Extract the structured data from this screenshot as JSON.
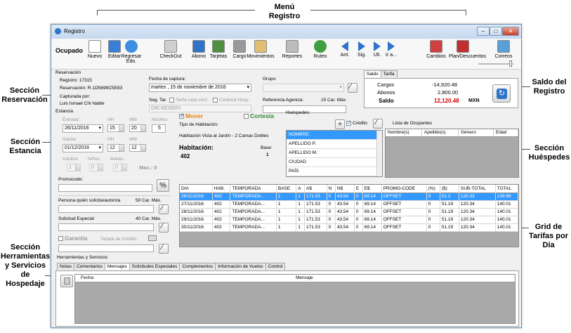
{
  "callouts": {
    "menu": "Menú",
    "menu2": "Registro",
    "reservacion": "Sección\nReservación",
    "estancia": "Sección\nEstancia",
    "herramientas": "Sección\nHerramientas\ny Servicios de\nHospedaje",
    "saldo": "Saldo del\nRegistro",
    "huespedes": "Sección\nHuéspedes",
    "grid": "Grid de\nTarifas por\nDía"
  },
  "window": {
    "title": "Registro"
  },
  "toolbar": {
    "status": "Ocupado",
    "buttons": [
      {
        "label": "Nuevo",
        "icon": "new-doc-icon"
      },
      {
        "label": "Editar",
        "icon": "pencil-icon"
      },
      {
        "label": "Regresar Edo.",
        "icon": "pie-icon"
      },
      {
        "label": "CheckOut",
        "icon": "checkout-icon"
      },
      {
        "label": "Abono",
        "icon": "abono-icon"
      },
      {
        "label": "Tarjetas",
        "icon": "cards-icon"
      },
      {
        "label": "Cargo",
        "icon": "printer-icon"
      },
      {
        "label": "Movimientos",
        "icon": "movements-icon"
      },
      {
        "label": "Reportes",
        "icon": "report-icon"
      },
      {
        "label": "Ruteo",
        "icon": "route-icon"
      },
      {
        "label": "Ant.",
        "icon": "prev-icon"
      },
      {
        "label": "Sig.",
        "icon": "next-icon"
      },
      {
        "label": "Ult.",
        "icon": "last-icon"
      },
      {
        "label": "Ir a...",
        "icon": "goto-icon"
      },
      {
        "label": "Cambios",
        "icon": "changes-icon"
      },
      {
        "label": "Plan/Descuentos",
        "icon": "tag-icon"
      },
      {
        "label": "Correos",
        "icon": "mail-icon"
      }
    ]
  },
  "reservacion": {
    "section": "Reservación",
    "registro": "Registro:  17315",
    "reservacion": "Reservación:  R-1D5699C5E83",
    "capturada_label": "Capturada por:",
    "capturada": "Luis Ismael Chi Nabte",
    "fecha_label": "Fecha de captura:",
    "fecha": "martes  , 15 de noviembre de 2016",
    "seg_tar": "Seg. Tar.",
    "tarifa_neta": "Tarifa neta conf.",
    "cortesia_hosp": "Cortesía Hosp.",
    "dir_reserv": "DIR.RESERV.",
    "grupo_label": "Grupo:",
    "ref_agencia": "Referencia Agencia:",
    "car_max": "15 Car. Máx."
  },
  "saldo": {
    "tab1": "Saldo",
    "tab2": "Tarifa",
    "cargos_label": "Cargos",
    "cargos": "-14,920.48",
    "abonos_label": "Abonos",
    "abonos": "2,800.00",
    "saldo_label": "Saldo",
    "saldo": "12,120.48",
    "moneda": "MXN",
    "saldo_color": "#d40000"
  },
  "estancia": {
    "section": "Estancia",
    "entrada": "Entrada:",
    "entrada_val": "26/11/2016",
    "hh": "HH",
    "mm": "MM",
    "noches": "Noches:",
    "hh1": "15",
    "mm1": "20",
    "noches_val": "5",
    "salida": "Salida:",
    "salida_val": "01/12/2016",
    "hh2": "12",
    "mm2": "12",
    "adultos": "Adultos:",
    "ninos": "Niños:",
    "bebes": "Bebes:",
    "adultos_val": "1",
    "ninos_val": "0",
    "bebes_val": "0",
    "max": "Max.: 0",
    "mover": "Mover",
    "cortesia": "Cortesía",
    "tipo_hab_label": "Tipo de Habitación:",
    "tipo_hab": "Habitación Vista al Jardín - 2 Camas Dobles",
    "habitacion_label": "Habitación:",
    "habitacion": "402",
    "base_label": "Base:",
    "base": "1"
  },
  "herramientas_left": {
    "promocode": "Promocode:",
    "persona": "Persona quién solicita/autoriza",
    "car50": "50 Car. Máx.",
    "solicitud": "Solicitud Especial",
    "car40": "40 Car. Máx.",
    "garantia": "Garantía",
    "tarjeta_credito": "Tarjeta de Crédito:"
  },
  "huespedes": {
    "label": "Huéspedes:",
    "credito": "Crédito",
    "lista": "Lista de Ocupantes",
    "campos": [
      "NOMBRE:",
      "APELLIDO P.",
      "APELLIDO M.",
      "CIUDAD",
      "PAÍS"
    ],
    "columns": [
      "Nombre(s)",
      "Apellido(s)",
      "Género",
      "Edad"
    ]
  },
  "tarifas": {
    "columns": [
      "DIA",
      "HAB.",
      "TEMPORADA",
      "BASE",
      "A",
      "A$",
      "N",
      "N$",
      "E",
      "E$",
      "PROMO-CODE",
      "(%)",
      "($)",
      "SUB-TOTAL",
      "TOTAL"
    ],
    "rows": [
      [
        "26/11/2016",
        "402",
        "TEMPORADA...",
        "1",
        "1",
        "171.53",
        "0",
        "43.54",
        "0",
        "69.14",
        "OFFSET",
        "0",
        "51.2",
        "120.33",
        "139.99"
      ],
      [
        "27/11/2016",
        "402",
        "TEMPORADA...",
        "1",
        "1",
        "171.53",
        "0",
        "43.54",
        "0",
        "69.14",
        "OFFSET",
        "0",
        "51.19",
        "120.34",
        "140.01"
      ],
      [
        "28/11/2016",
        "402",
        "TEMPORADA...",
        "1",
        "1",
        "171.53",
        "0",
        "43.54",
        "0",
        "69.14",
        "OFFSET",
        "0",
        "51.19",
        "120.34",
        "140.01"
      ],
      [
        "29/11/2016",
        "402",
        "TEMPORADA...",
        "1",
        "1",
        "171.53",
        "0",
        "43.54",
        "0",
        "69.14",
        "OFFSET",
        "0",
        "51.19",
        "120.34",
        "140.01"
      ],
      [
        "30/11/2016",
        "402",
        "TEMPORADA...",
        "1",
        "1",
        "171.53",
        "0",
        "43.54",
        "0",
        "69.14",
        "OFFSET",
        "0",
        "51.19",
        "120.34",
        "140.01"
      ]
    ]
  },
  "servicios": {
    "section": "Herramientas y Servicios",
    "tabs": [
      "Notas",
      "Comentarios",
      "Mensajes",
      "Solicitudes Especiales",
      "Complementos",
      "Información de Vuelos",
      "Control"
    ],
    "active_tab": "Mensajes",
    "columns": [
      "Fecha",
      "Mensaje"
    ]
  }
}
